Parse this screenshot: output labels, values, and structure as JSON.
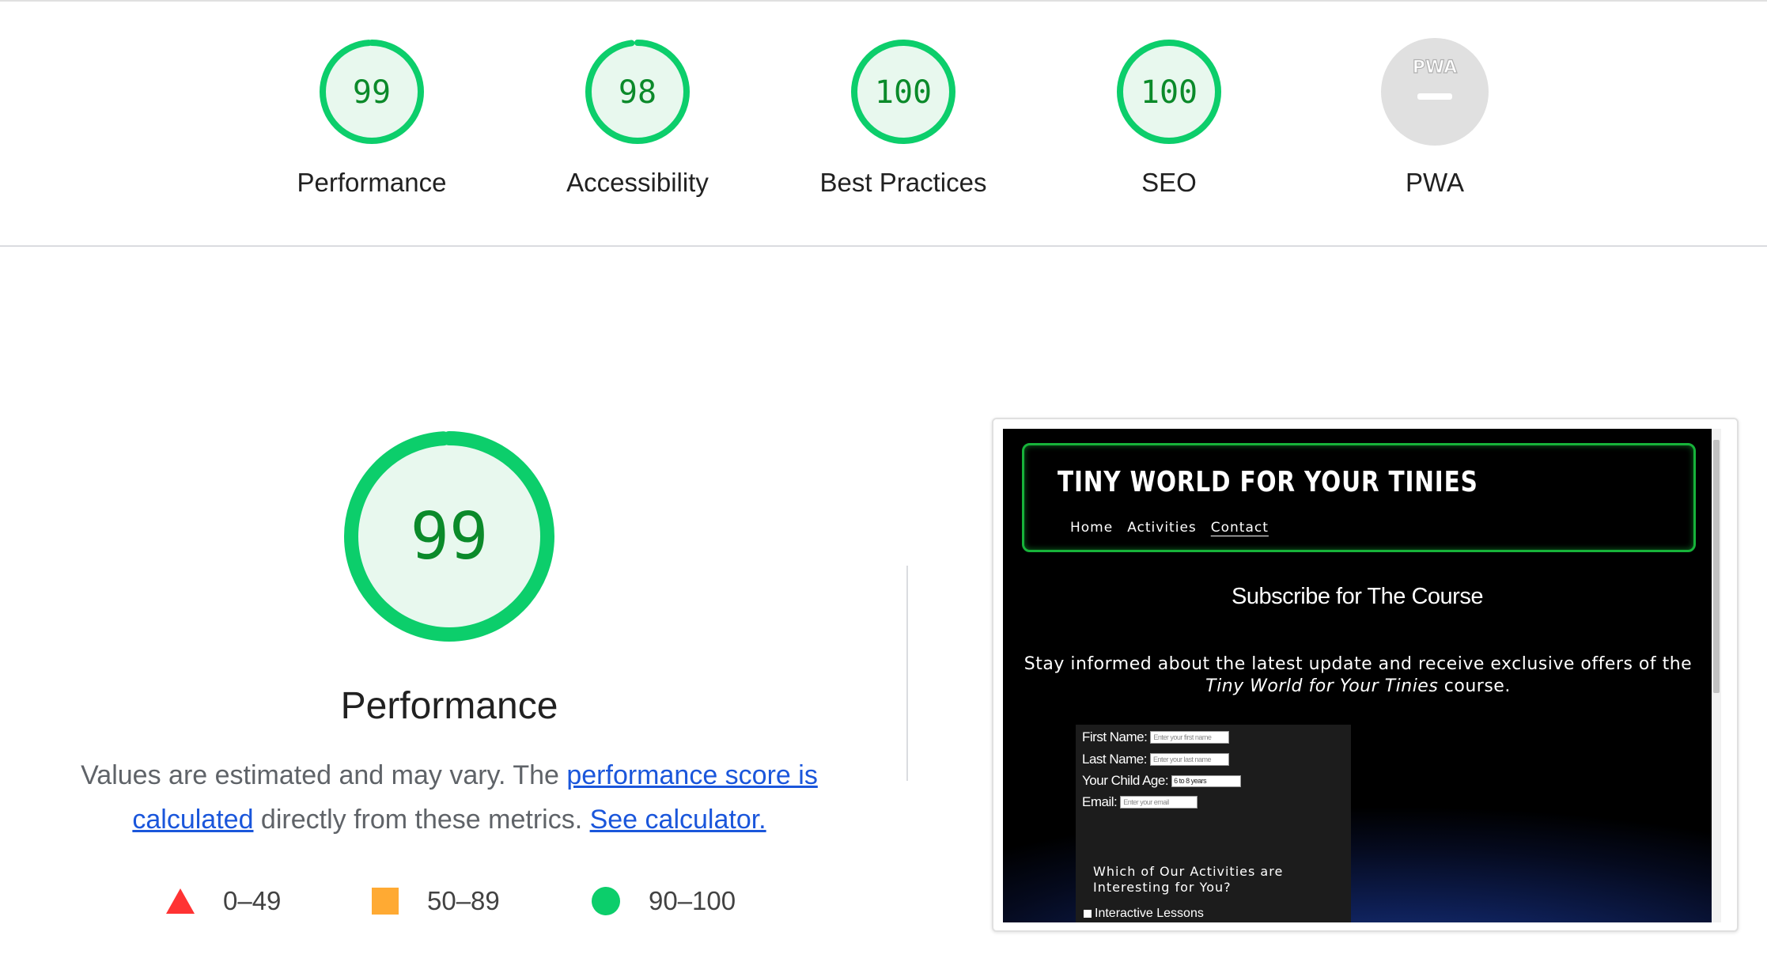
{
  "categories": [
    {
      "label": "Performance",
      "score": "99",
      "fraction": 0.99,
      "state": "pass"
    },
    {
      "label": "Accessibility",
      "score": "98",
      "fraction": 0.98,
      "state": "pass"
    },
    {
      "label": "Best Practices",
      "score": "100",
      "fraction": 1.0,
      "state": "pass"
    },
    {
      "label": "SEO",
      "score": "100",
      "fraction": 1.0,
      "state": "pass"
    },
    {
      "label": "PWA",
      "badge": "PWA",
      "state": "na"
    }
  ],
  "performance": {
    "score": "99",
    "fraction": 0.99,
    "title": "Performance",
    "desc_before": "Values are estimated and may vary. The ",
    "desc_link1": "performance score is calculated",
    "desc_middle": " directly from these metrics. ",
    "desc_link2": "See calculator."
  },
  "legend": [
    {
      "range": "0–49",
      "shape": "triangle",
      "color": "#ff3333"
    },
    {
      "range": "50–89",
      "shape": "square",
      "color": "#ffaa33"
    },
    {
      "range": "90–100",
      "shape": "circle",
      "color": "#0cce6b"
    }
  ],
  "colors": {
    "pass": "#0cce6b",
    "pass_fill": "#e8f8ee",
    "pass_text": "#0b8a2a",
    "na": "#e0e0e0"
  },
  "screenshot": {
    "site_title": "TINY WORLD FOR YOUR TINIES",
    "nav": [
      "Home",
      "Activities",
      "Contact"
    ],
    "heading": "Subscribe for The Course",
    "para_before": "Stay informed about the latest update and receive exclusive offers of the ",
    "para_em": "Tiny World for Your Tinies",
    "para_after": " course.",
    "form": {
      "first_name_label": "First Name:",
      "first_name_placeholder": "Enter your first name",
      "last_name_label": "Last Name:",
      "last_name_placeholder": "Enter your last name",
      "age_label": "Your Child Age:",
      "age_value": "6 to 8 years",
      "email_label": "Email:",
      "email_placeholder": "Enter your email",
      "question": "Which of Our Activities are Interesting for You?",
      "option1": "Interactive Lessons"
    }
  }
}
